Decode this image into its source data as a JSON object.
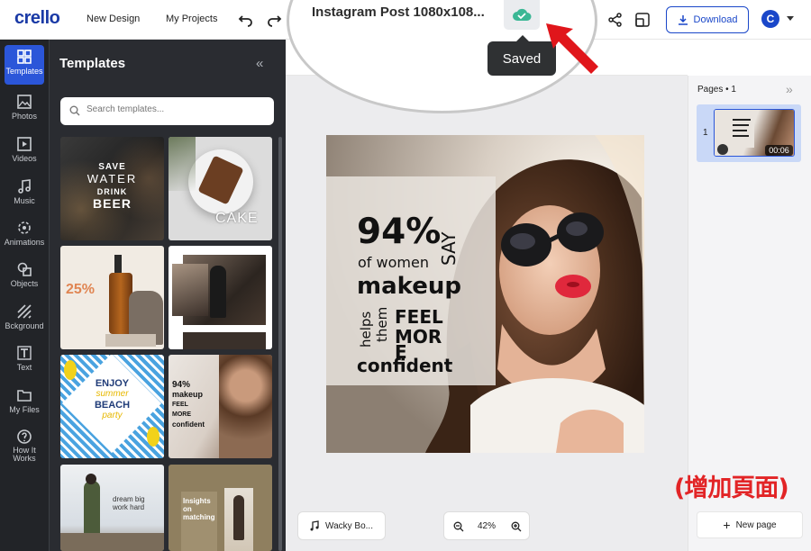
{
  "app": {
    "logo": "crello",
    "nav": [
      "New Design",
      "My Projects"
    ],
    "download_label": "Download",
    "avatar_letter": "C"
  },
  "callout": {
    "document_title": "Instagram Post 1080x108...",
    "saved_tooltip": "Saved"
  },
  "rail": {
    "items": [
      {
        "label": "Templates",
        "icon": "grid-icon"
      },
      {
        "label": "Photos",
        "icon": "image-icon"
      },
      {
        "label": "Videos",
        "icon": "video-icon"
      },
      {
        "label": "Music",
        "icon": "music-note-icon"
      },
      {
        "label": "Animations",
        "icon": "animation-icon"
      },
      {
        "label": "Objects",
        "icon": "shapes-icon"
      },
      {
        "label": "Bckground",
        "icon": "background-icon"
      },
      {
        "label": "Text",
        "icon": "text-icon"
      },
      {
        "label": "My Files",
        "icon": "folder-icon"
      },
      {
        "label": "How It Works",
        "icon": "help-icon"
      }
    ]
  },
  "panel": {
    "title": "Templates",
    "search_placeholder": "Search templates...",
    "thumbs": {
      "t1": [
        "SAVE",
        "WATER",
        "DRINK",
        "BEER"
      ],
      "t2": "CAKE",
      "t3": "25%",
      "t5": [
        "ENJOY",
        "summer",
        "BEACH",
        "party"
      ],
      "t6": [
        "94%",
        "makeup",
        "FEEL",
        "MORE",
        "confident"
      ],
      "t7": [
        "dream big",
        "work hard"
      ],
      "t8": [
        "Insights",
        "on",
        "matching"
      ]
    }
  },
  "design": {
    "lines": {
      "percent": "94%",
      "of_women": "of women",
      "say": "SAY",
      "makeup": "makeup",
      "helps": "helps",
      "them": "them",
      "feel": "FEEL",
      "mor": "MOR",
      "e": "E",
      "confident": "confident"
    }
  },
  "bottom": {
    "music_label": "Wacky Bo...",
    "zoom_level": "42%"
  },
  "pages": {
    "title": "Pages • 1",
    "page_number": "1",
    "duration": "00:06",
    "new_page_label": "New page"
  },
  "annotation": {
    "chinese_label": "(增加頁面)"
  },
  "colors": {
    "accent": "#2b56d9",
    "rail_bg": "#222428",
    "panel_bg": "#2a2c31",
    "annotation_red": "#e22426"
  }
}
